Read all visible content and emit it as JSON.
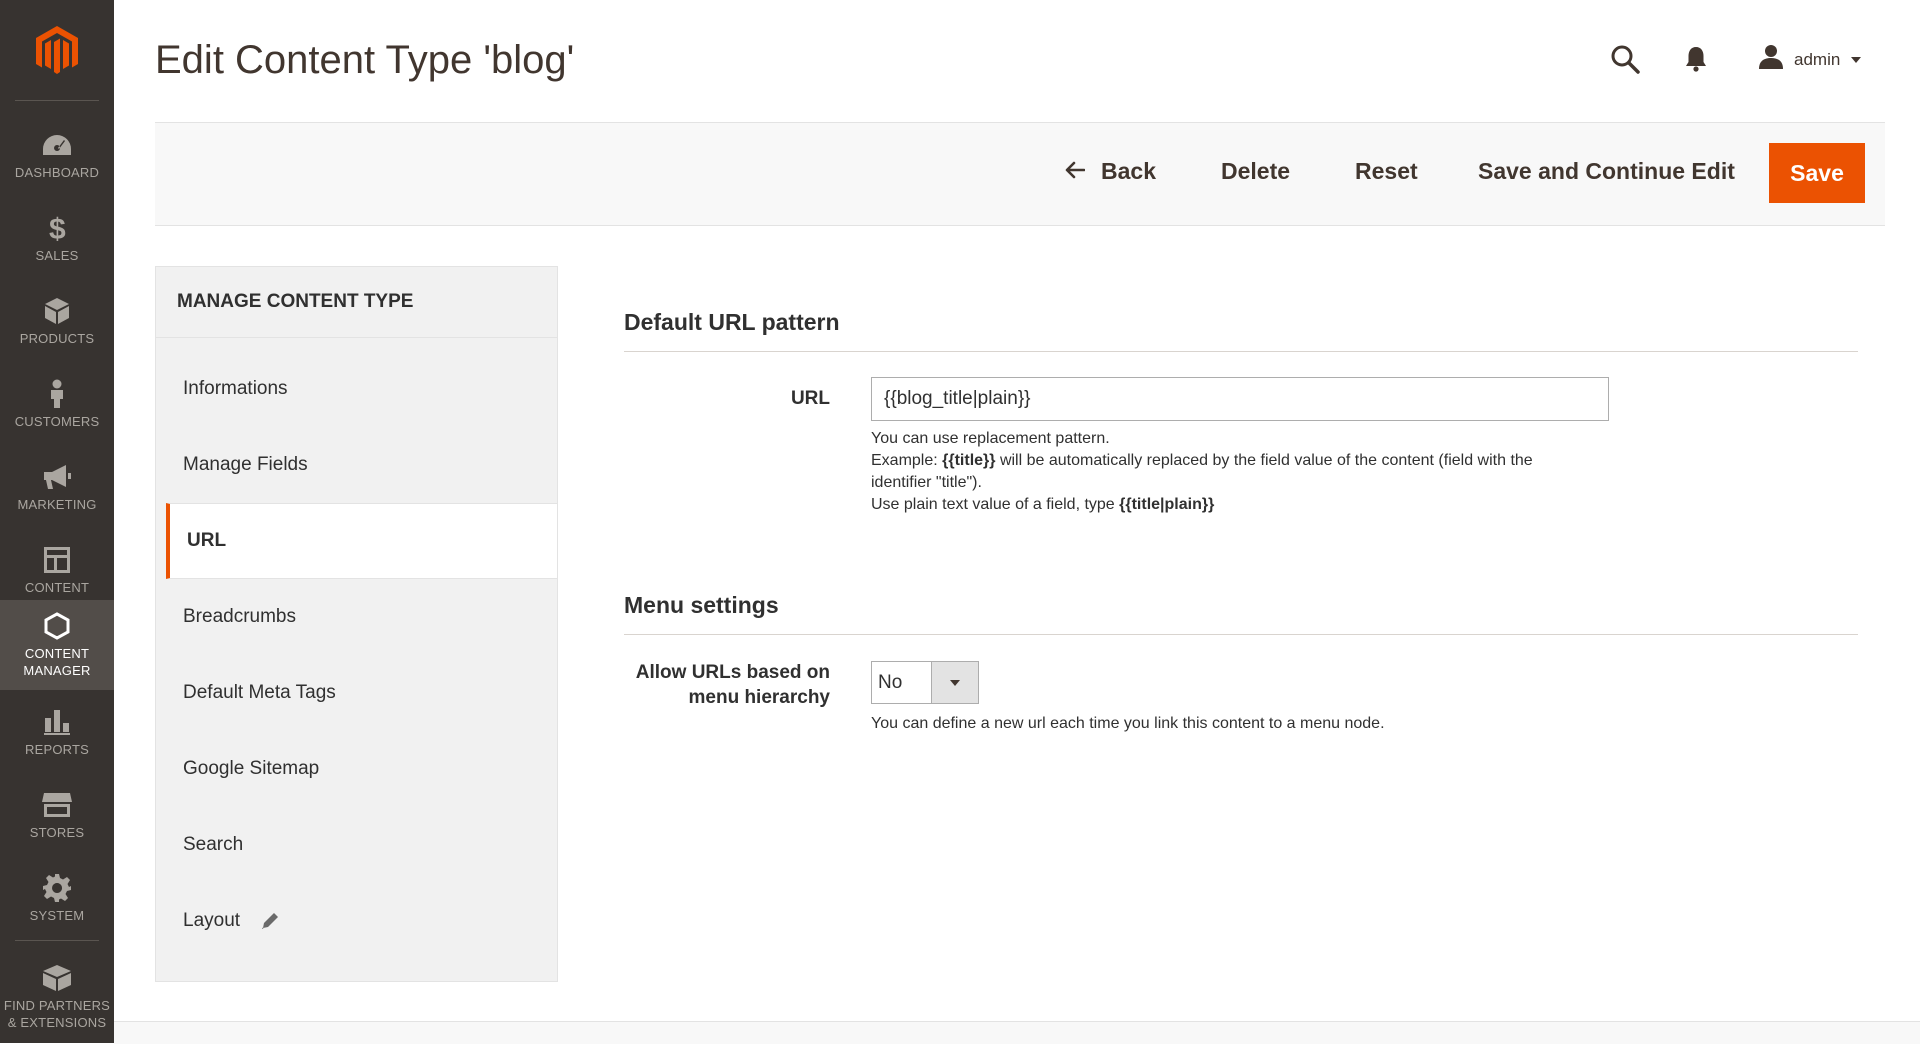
{
  "sidebar": {
    "logo": "magento-logo",
    "items": [
      {
        "label": "DASHBOARD",
        "icon": "dashboard-icon"
      },
      {
        "label": "SALES",
        "icon": "dollar-icon"
      },
      {
        "label": "PRODUCTS",
        "icon": "cube-icon"
      },
      {
        "label": "CUSTOMERS",
        "icon": "person-icon"
      },
      {
        "label": "MARKETING",
        "icon": "megaphone-icon"
      },
      {
        "label": "CONTENT",
        "icon": "layout-icon"
      },
      {
        "label": "CONTENT MANAGER",
        "icon": "hexagon-icon",
        "active": true
      },
      {
        "label": "REPORTS",
        "icon": "bar-chart-icon"
      },
      {
        "label": "STORES",
        "icon": "storefront-icon"
      },
      {
        "label": "SYSTEM",
        "icon": "gear-icon"
      },
      {
        "label": "FIND PARTNERS & EXTENSIONS",
        "icon": "boxes-icon"
      }
    ]
  },
  "header": {
    "title": "Edit Content Type 'blog'",
    "user": "admin"
  },
  "actions": {
    "back": "Back",
    "delete": "Delete",
    "reset": "Reset",
    "save_continue": "Save and Continue Edit",
    "save": "Save"
  },
  "tabs": {
    "title": "MANAGE CONTENT TYPE",
    "items": [
      {
        "label": "Informations"
      },
      {
        "label": "Manage Fields"
      },
      {
        "label": "URL",
        "active": true
      },
      {
        "label": "Breadcrumbs"
      },
      {
        "label": "Default Meta Tags"
      },
      {
        "label": "Google Sitemap"
      },
      {
        "label": "Search"
      },
      {
        "label": "Layout",
        "icon": "pencil-icon"
      }
    ]
  },
  "url_section": {
    "title": "Default URL pattern",
    "url_label": "URL",
    "url_value": "{{blog_title|plain}}",
    "note_line1": "You can use replacement pattern.",
    "note_example_prefix": "Example: ",
    "note_example_code": "{{title}}",
    "note_example_suffix": " will be automatically replaced by the field value of the content (field with the",
    "note_line3": "identifier \"title\").",
    "note_line4_prefix": "Use plain text value of a field, type ",
    "note_line4_code": "{{title|plain}}"
  },
  "menu_section": {
    "title": "Menu settings",
    "label_line1": "Allow URLs based on",
    "label_line2": "menu hierarchy",
    "select_value": "No",
    "note": "You can define a new url each time you link this content to a menu node."
  },
  "colors": {
    "accent": "#eb5202",
    "sidebar": "#373330",
    "sidebar_active": "#524d49"
  }
}
